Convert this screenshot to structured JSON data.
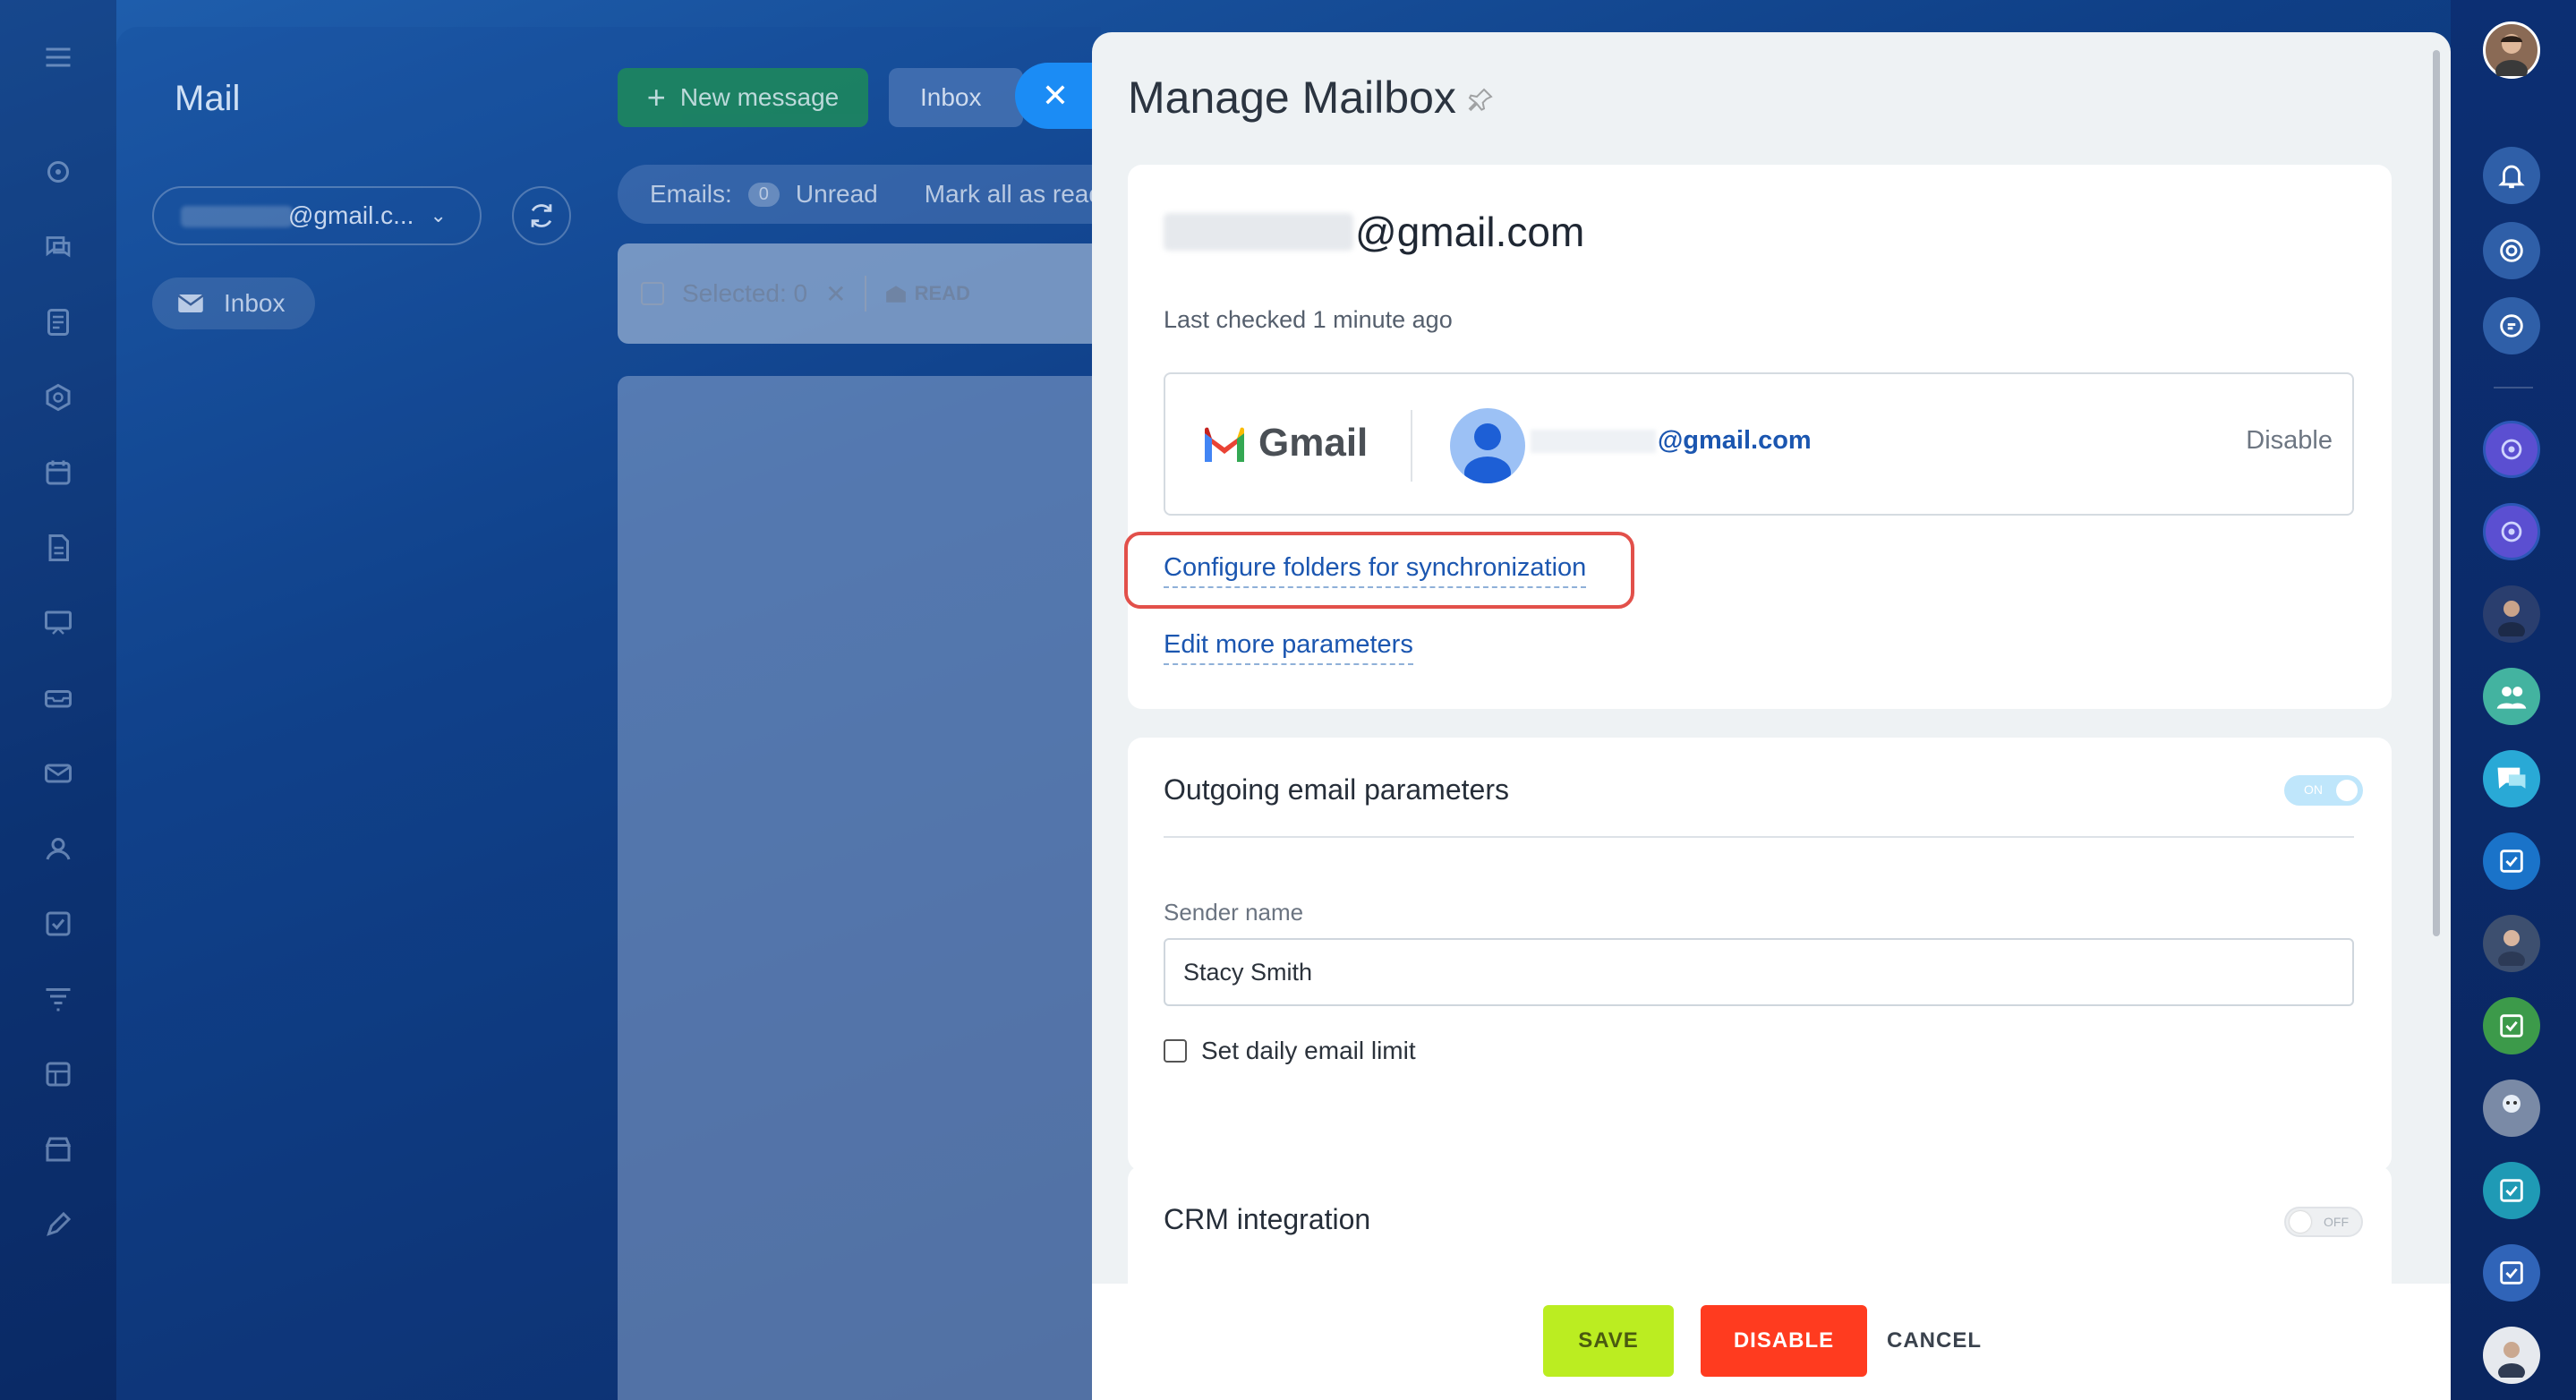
{
  "mail": {
    "title": "Mail",
    "account_suffix": "@gmail.c...",
    "inbox_label": "Inbox",
    "new_message_label": "New message",
    "inbox_tab_label": "Inbox",
    "emails_label": "Emails:",
    "unread_count": "0",
    "unread_label": "Unread",
    "mark_all_label": "Mark all as read",
    "selected_label": "Selected: 0",
    "read_label": "READ"
  },
  "panel": {
    "title": "Manage Mailbox",
    "email_suffix": "@gmail.com",
    "last_checked": "Last checked 1 minute ago",
    "provider_name": "Gmail",
    "account_email_suffix": "@gmail.com",
    "disable_link": "Disable",
    "configure_folders_link": "Configure folders for synchronization",
    "edit_params_link": "Edit more parameters",
    "outgoing": {
      "title": "Outgoing email parameters",
      "toggle_state": "ON",
      "sender_label": "Sender name",
      "sender_value": "Stacy Smith",
      "daily_limit_label": "Set daily email limit"
    },
    "crm": {
      "title": "CRM integration",
      "toggle_state": "OFF"
    },
    "buttons": {
      "save": "SAVE",
      "disable": "DISABLE",
      "cancel": "CANCEL"
    }
  },
  "colors": {
    "link": "#1b56b0",
    "save": "#bbed21",
    "disable": "#ff3b1f",
    "highlight": "#e2504a",
    "close_fab": "#1b8cf5"
  }
}
